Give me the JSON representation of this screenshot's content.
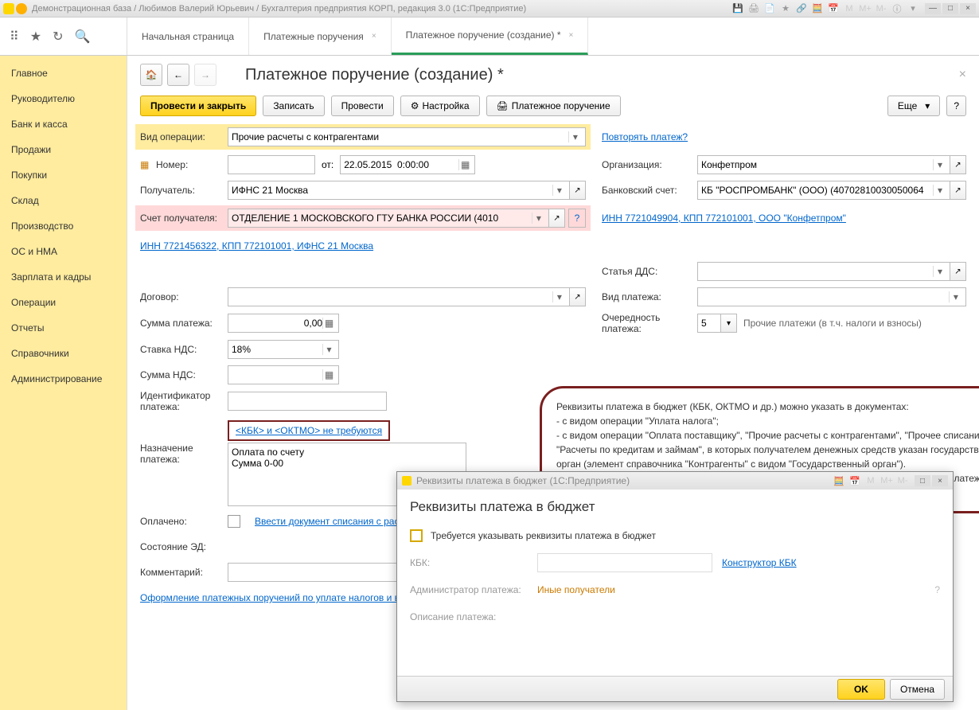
{
  "titlebar": "Демонстрационная база / Любимов Валерий Юрьевич / Бухгалтерия предприятия КОРП, редакция 3.0  (1С:Предприятие)",
  "tabs": {
    "t0": "Начальная страница",
    "t1": "Платежные поручения",
    "t2": "Платежное поручение (создание) *"
  },
  "sidebar": [
    "Главное",
    "Руководителю",
    "Банк и касса",
    "Продажи",
    "Покупки",
    "Склад",
    "Производство",
    "ОС и НМА",
    "Зарплата и кадры",
    "Операции",
    "Отчеты",
    "Справочники",
    "Администрирование"
  ],
  "page_title": "Платежное поручение (создание) *",
  "buttons": {
    "post_close": "Провести и закрыть",
    "save": "Записать",
    "post": "Провести",
    "settings": "Настройка",
    "print": "Платежное поручение",
    "more": "Еще"
  },
  "labels": {
    "op_type": "Вид операции:",
    "number": "Номер:",
    "from": "от:",
    "recipient": "Получатель:",
    "rec_account": "Счет получателя:",
    "contract": "Договор:",
    "amount": "Сумма платежа:",
    "vat_rate": "Ставка НДС:",
    "vat_sum": "Сумма НДС:",
    "payment_id": "Идентификатор платежа:",
    "purpose": "Назначение платежа:",
    "paid": "Оплачено:",
    "ed_state": "Состояние ЭД:",
    "comment": "Комментарий:",
    "org": "Организация:",
    "bank_acc": "Банковский счет:",
    "dds": "Статья ДДС:",
    "pay_type": "Вид платежа:",
    "priority": "Очередность платежа:"
  },
  "values": {
    "op_type": "Прочие расчеты с контрагентами",
    "date": "22.05.2015  0:00:00",
    "recipient": "ИФНС 21 Москва",
    "rec_account": "ОТДЕЛЕНИЕ 1 МОСКОВСКОГО ГТУ БАНКА РОССИИ (4010",
    "amount": "0,00",
    "vat_rate": "18%",
    "org": "Конфетпром",
    "bank_acc": "КБ \"РОСПРОМБАНК\" (ООО) (40702810030050064",
    "priority": "5",
    "priority_note": "Прочие платежи (в т.ч. налоги и взносы)",
    "purpose": "Оплата по счету\nСумма 0-00"
  },
  "links": {
    "repeat": "Повторять платеж?",
    "inn1": "ИНН 7721456322, КПП 772101001, ИФНС 21 Москва",
    "inn2": "ИНН 7721049904, КПП 772101001, ООО \"Конфетпром\"",
    "kbk": "<КБК> и <ОКТМО> не требуются",
    "write_off": "Ввести документ списания с расчетного счета",
    "tax_orders": "Оформление платежных поручений по уплате налогов и взносов"
  },
  "callout": "Реквизиты платежа в бюджет (КБК, ОКТМО и др.) можно указать в документах:\n- с видом операции \"Уплата налога\";\n- с видом операции \"Оплата поставщику\", \"Прочие расчеты с контрагентами\", \"Прочее списание\" и \"Расчеты по кредитам и займам\", в которых получателем денежных средств указан государственный орган (элемент справочника \"Контрагенты\" с видом \"Государственный орган\").\nВ документах, не связанных с уплатой налогов, можно отметить, что банк и получатель платежа не требуют указывать реквизиты платежа в бюджет.",
  "modal": {
    "title": "Реквизиты платежа в бюджет  (1С:Предприятие)",
    "header": "Реквизиты платежа в бюджет",
    "check_label": "Требуется указывать реквизиты платежа в бюджет",
    "kbk_label": "КБК:",
    "kbk_link": "Конструктор КБК",
    "admin_label": "Администратор платежа:",
    "admin_val": "Иные получатели",
    "desc_label": "Описание платежа:",
    "ok": "OK",
    "cancel": "Отмена"
  }
}
